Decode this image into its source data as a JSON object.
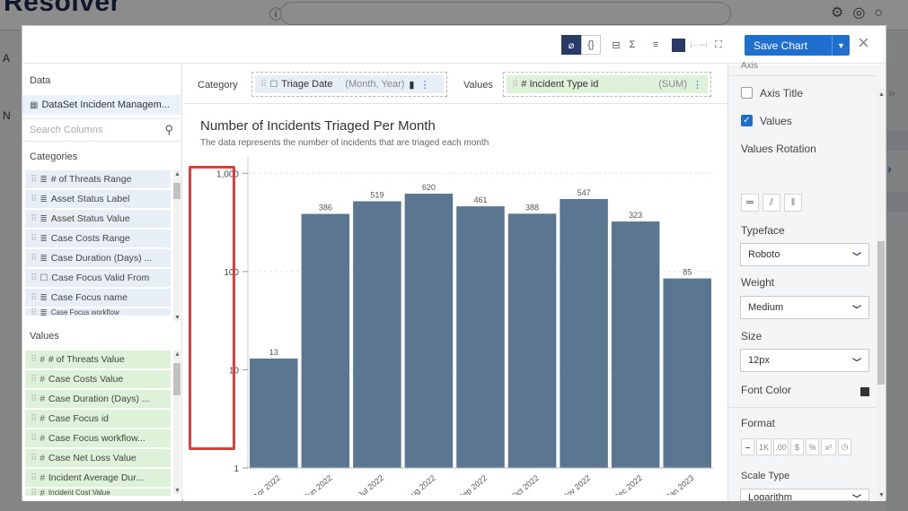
{
  "background": {
    "logo": "Resolver",
    "left_letters": [
      "A",
      "N"
    ]
  },
  "toolbar": {
    "save_label": "Save Chart"
  },
  "left_panel": {
    "data_title": "Data",
    "dataset": "DataSet Incident Managem...",
    "search_placeholder": "Search Columns",
    "categories_title": "Categories",
    "categories": [
      "# of Threats Range",
      "Asset Status Label",
      "Asset Status Value",
      "Case Costs Range",
      "Case Duration (Days) ...",
      "Case Focus Valid From",
      "Case Focus name",
      "Case Focus workflow"
    ],
    "values_title": "Values",
    "values": [
      "# of Threats Value",
      "Case Costs Value",
      "Case Duration (Days) ...",
      "Case Focus id",
      "Case Focus workflow...",
      "Case Net Loss Value",
      "Incident Average Dur...",
      "Incident Cost Value"
    ]
  },
  "dropzones": {
    "category_label": "Category",
    "category_field": "Triage Date",
    "category_mod": "(Month, Year)",
    "values_label": "Values",
    "values_field": "# Incident Type id",
    "values_mod": "(SUM)"
  },
  "chart": {
    "title": "Number of Incidents Triaged Per Month",
    "subtitle": "The data represents the number of incidents that are triaged each month"
  },
  "chart_data": {
    "type": "bar",
    "categories": [
      "Apr 2022",
      "Jun 2022",
      "Jul 2022",
      "Aug 2022",
      "Sep 2022",
      "Oct 2022",
      "Nov 2022",
      "Dec 2022",
      "Jan 2023"
    ],
    "values": [
      13,
      386,
      519,
      620,
      461,
      388,
      547,
      323,
      85
    ],
    "y_scale": "log",
    "y_ticks": [
      "1",
      "10",
      "100",
      "1,000"
    ],
    "ylim": [
      1,
      1500
    ],
    "grid": true,
    "bar_color": "#5a7690"
  },
  "right_panel": {
    "axis_cut_label": "Axis",
    "axis_title_label": "Axis Title",
    "values_label": "Values",
    "values_rotation_label": "Values Rotation",
    "typeface_label": "Typeface",
    "typeface_value": "Roboto",
    "weight_label": "Weight",
    "weight_value": "Medium",
    "size_label": "Size",
    "size_value": "12px",
    "font_color_label": "Font Color",
    "format_label": "Format",
    "format_buttons": [
      "1K",
      ".00",
      "$",
      "%"
    ],
    "scale_type_label": "Scale Type",
    "scale_type_value": "Logarithm"
  },
  "colors": {
    "accent": "#1f6fd1",
    "highlight": "#e03c3c",
    "category_pill": "#e8eef6",
    "value_pill": "#ddf2d8"
  }
}
